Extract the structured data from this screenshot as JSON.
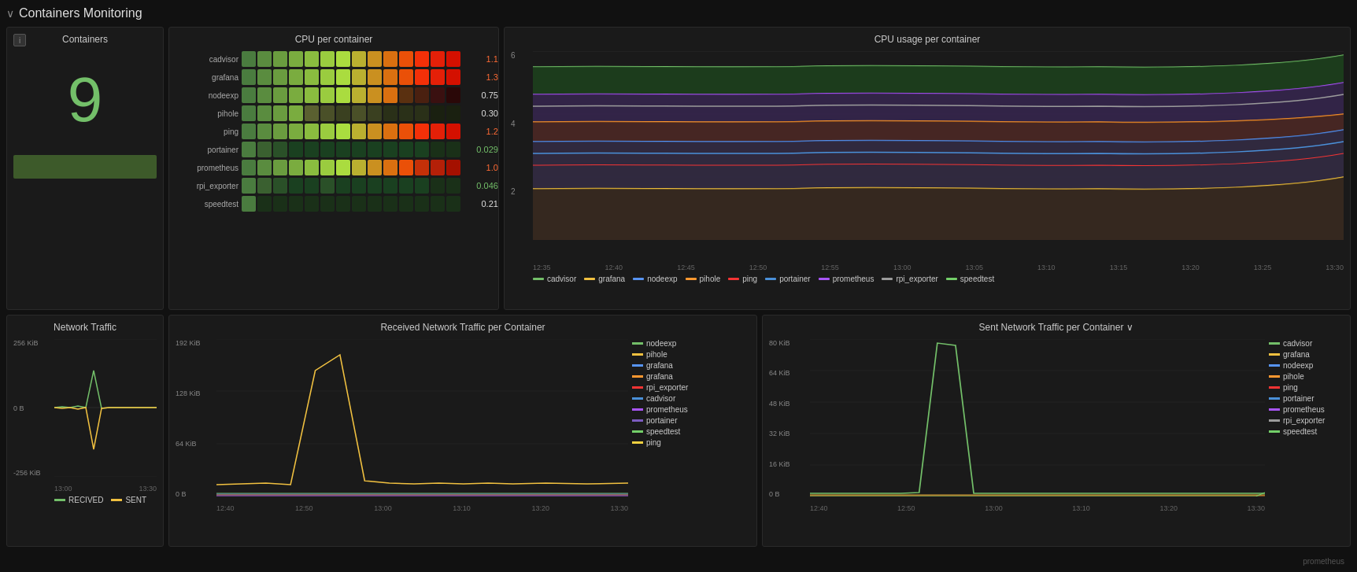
{
  "dashboard": {
    "title": "Containers Monitoring"
  },
  "containers_panel": {
    "title": "Containers",
    "count": "9"
  },
  "cpu_heatmap": {
    "title": "CPU per container",
    "rows": [
      {
        "label": "cadvisor",
        "value": "1.15",
        "value_color": "#ff6b35",
        "cells": [
          "#4a7c3f",
          "#5a8c3f",
          "#6a9c3f",
          "#7aac3f",
          "#8abc3f",
          "#9acc3f",
          "#aadc3f",
          "#bab030",
          "#ca9020",
          "#da7010",
          "#ea5008",
          "#f43008",
          "#e42008",
          "#d41000"
        ]
      },
      {
        "label": "grafana",
        "value": "1.32",
        "value_color": "#ff6b35",
        "cells": [
          "#4a7c3f",
          "#5a8c3f",
          "#6a9c3f",
          "#7aac3f",
          "#8abc3f",
          "#9acc3f",
          "#aadc3f",
          "#bab030",
          "#ca9020",
          "#da7010",
          "#ea5008",
          "#f43008",
          "#e42008",
          "#d41000"
        ]
      },
      {
        "label": "nodeexp",
        "value": "0.756",
        "value_color": "#e0e0e0",
        "cells": [
          "#4a7c3f",
          "#5a8c3f",
          "#6a9c3f",
          "#7aac3f",
          "#8abc3f",
          "#9acc3f",
          "#aadc3f",
          "#bab030",
          "#ca9020",
          "#da7010",
          "#5a3010",
          "#4a2010",
          "#3a1010",
          "#2a0808"
        ]
      },
      {
        "label": "pihole",
        "value": "0.305",
        "value_color": "#e0e0e0",
        "cells": [
          "#4a7c3f",
          "#5a8c3f",
          "#6a9c3f",
          "#7aac3f",
          "#5a6030",
          "#4a5028",
          "#3a4020",
          "#4a5028",
          "#3a4020",
          "#2a3018",
          "#2a3018",
          "#2a3018",
          "#1a2010",
          "#1a2010"
        ]
      },
      {
        "label": "ping",
        "value": "1.24",
        "value_color": "#ff6b35",
        "cells": [
          "#4a7c3f",
          "#5a8c3f",
          "#6a9c3f",
          "#7aac3f",
          "#8abc3f",
          "#9acc3f",
          "#aadc3f",
          "#bab030",
          "#ca9020",
          "#da7010",
          "#ea5008",
          "#f43008",
          "#e42008",
          "#d41000"
        ]
      },
      {
        "label": "portainer",
        "value": "0.0297",
        "value_color": "#73bf69",
        "cells": [
          "#4a7c3f",
          "#3a6030",
          "#2a5028",
          "#1a4020",
          "#1a4020",
          "#1a4020",
          "#1a4020",
          "#1a4020",
          "#1a4020",
          "#1a4020",
          "#1a4020",
          "#1a4020",
          "#1a3018",
          "#1a3018"
        ]
      },
      {
        "label": "prometheus",
        "value": "1.08",
        "value_color": "#ff6b35",
        "cells": [
          "#4a7c3f",
          "#5a8c3f",
          "#6a9c3f",
          "#7aac3f",
          "#8abc3f",
          "#9acc3f",
          "#aadc3f",
          "#bab030",
          "#ca9020",
          "#da7010",
          "#ea5008",
          "#c43008",
          "#b42008",
          "#a41000"
        ]
      },
      {
        "label": "rpi_exporter",
        "value": "0.0463",
        "value_color": "#73bf69",
        "cells": [
          "#4a7c3f",
          "#3a6030",
          "#2a5028",
          "#1a4020",
          "#1a4020",
          "#2a5028",
          "#1a4020",
          "#1a4020",
          "#1a4020",
          "#1a4020",
          "#1a4020",
          "#1a4020",
          "#1a3018",
          "#1a3018"
        ]
      },
      {
        "label": "speedtest",
        "value": "0.212",
        "value_color": "#e0e0e0",
        "cells": [
          "#4a7c3f",
          "#1a3018",
          "#1a3018",
          "#1a3018",
          "#1a3018",
          "#1a3018",
          "#1a3018",
          "#1a3018",
          "#1a3018",
          "#1a3018",
          "#1a3018",
          "#1a3018",
          "#1a3018",
          "#1a3018"
        ]
      }
    ]
  },
  "cpu_usage": {
    "title": "CPU usage per container",
    "y_labels": [
      "6",
      "4",
      "2"
    ],
    "x_labels": [
      "12:35",
      "12:40",
      "12:45",
      "12:50",
      "12:55",
      "13:00",
      "13:05",
      "13:10",
      "13:15",
      "13:20",
      "13:25",
      "13:30"
    ],
    "legend": [
      {
        "label": "cadvisor",
        "color": "#73bf69"
      },
      {
        "label": "grafana",
        "color": "#f0c040"
      },
      {
        "label": "nodeexp",
        "color": "#5794f2"
      },
      {
        "label": "pihole",
        "color": "#ff9830"
      },
      {
        "label": "ping",
        "color": "#f43434"
      },
      {
        "label": "portainer",
        "color": "#4a90d9"
      },
      {
        "label": "prometheus",
        "color": "#a855f7"
      },
      {
        "label": "rpi_exporter",
        "color": "#9b9b9b"
      },
      {
        "label": "speedtest",
        "color": "#73bf69"
      }
    ]
  },
  "network_traffic": {
    "title": "Network Traffic",
    "y_labels": [
      "256 KiB",
      "0 B",
      "-256 KiB"
    ],
    "x_labels": [
      "13:00",
      "13:30"
    ],
    "legend": [
      {
        "label": "RECIVED",
        "color": "#73bf69"
      },
      {
        "label": "SENT",
        "color": "#f0c040"
      }
    ]
  },
  "received_traffic": {
    "title": "Received Network Traffic per Container",
    "y_labels": [
      "192 KiB",
      "128 KiB",
      "64 KiB",
      "0 B"
    ],
    "x_labels": [
      "12:40",
      "12:50",
      "13:00",
      "13:10",
      "13:20",
      "13:30"
    ],
    "legend": [
      {
        "label": "nodeexp",
        "color": "#73bf69"
      },
      {
        "label": "pihole",
        "color": "#f0c040"
      },
      {
        "label": "grafana",
        "color": "#5794f2"
      },
      {
        "label": "grafana",
        "color": "#ff9830"
      },
      {
        "label": "rpi_exporter",
        "color": "#f43434"
      },
      {
        "label": "cadvisor",
        "color": "#4a90d9"
      },
      {
        "label": "prometheus",
        "color": "#a855f7"
      },
      {
        "label": "portainer",
        "color": "#7c5cbf"
      },
      {
        "label": "speedtest",
        "color": "#73cf69"
      },
      {
        "label": "ping",
        "color": "#f0d040"
      }
    ]
  },
  "sent_traffic": {
    "title": "Sent Network Traffic per Container",
    "y_labels": [
      "80 KiB",
      "64 KiB",
      "48 KiB",
      "32 KiB",
      "16 KiB",
      "0 B"
    ],
    "x_labels": [
      "12:40",
      "12:50",
      "13:00",
      "13:10",
      "13:20",
      "13:30"
    ],
    "legend": [
      {
        "label": "cadvisor",
        "color": "#73bf69"
      },
      {
        "label": "grafana",
        "color": "#f0c040"
      },
      {
        "label": "nodeexp",
        "color": "#5794f2"
      },
      {
        "label": "pihole",
        "color": "#ff9830"
      },
      {
        "label": "ping",
        "color": "#f43434"
      },
      {
        "label": "portainer",
        "color": "#4a90d9"
      },
      {
        "label": "prometheus",
        "color": "#a855f7"
      },
      {
        "label": "rpi_exporter",
        "color": "#9b9b9b"
      },
      {
        "label": "speedtest",
        "color": "#73cf69"
      }
    ]
  },
  "footer": {
    "datasource": "prometheus"
  }
}
